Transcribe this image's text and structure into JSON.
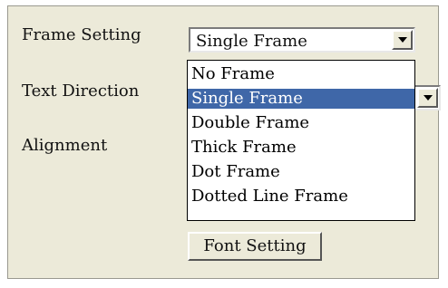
{
  "labels": {
    "frame_setting": "Frame Setting",
    "text_direction": "Text Direction",
    "alignment": "Alignment"
  },
  "frame_select": {
    "value": "Single Frame"
  },
  "frame_options": [
    {
      "label": "No Frame",
      "selected": false
    },
    {
      "label": "Single Frame",
      "selected": true
    },
    {
      "label": "Double Frame",
      "selected": false
    },
    {
      "label": "Thick Frame",
      "selected": false
    },
    {
      "label": "Dot Frame",
      "selected": false
    },
    {
      "label": "Dotted Line Frame",
      "selected": false
    }
  ],
  "buttons": {
    "font_setting": "Font Setting"
  },
  "colors": {
    "panel_bg": "#ecead9",
    "selection": "#3f67a8"
  },
  "icons": {
    "dropdown": "chevron-down-icon"
  }
}
